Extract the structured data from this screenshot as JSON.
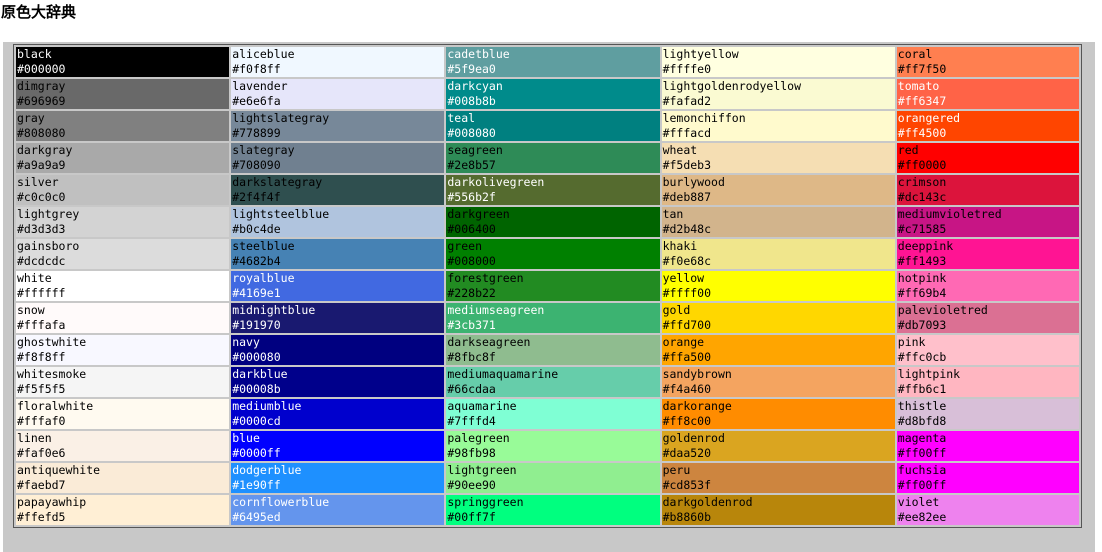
{
  "page": {
    "title": "原色大辞典"
  },
  "columns": [
    [
      {
        "name": "black",
        "hex": "#000000",
        "fg": "#ffffff"
      },
      {
        "name": "dimgray",
        "hex": "#696969",
        "fg": "#000000"
      },
      {
        "name": "gray",
        "hex": "#808080",
        "fg": "#000000"
      },
      {
        "name": "darkgray",
        "hex": "#a9a9a9",
        "fg": "#000000"
      },
      {
        "name": "silver",
        "hex": "#c0c0c0",
        "fg": "#000000"
      },
      {
        "name": "lightgrey",
        "hex": "#d3d3d3",
        "fg": "#000000"
      },
      {
        "name": "gainsboro",
        "hex": "#dcdcdc",
        "fg": "#000000"
      },
      {
        "name": "white",
        "hex": "#ffffff",
        "fg": "#000000"
      },
      {
        "name": "snow",
        "hex": "#fffafa",
        "fg": "#000000"
      },
      {
        "name": "ghostwhite",
        "hex": "#f8f8ff",
        "fg": "#000000"
      },
      {
        "name": "whitesmoke",
        "hex": "#f5f5f5",
        "fg": "#000000"
      },
      {
        "name": "floralwhite",
        "hex": "#fffaf0",
        "fg": "#000000"
      },
      {
        "name": "linen",
        "hex": "#faf0e6",
        "fg": "#000000"
      },
      {
        "name": "antiquewhite",
        "hex": "#faebd7",
        "fg": "#000000"
      },
      {
        "name": "papayawhip",
        "hex": "#ffefd5",
        "fg": "#000000"
      }
    ],
    [
      {
        "name": "aliceblue",
        "hex": "#f0f8ff",
        "fg": "#000000"
      },
      {
        "name": "lavender",
        "hex": "#e6e6fa",
        "fg": "#000000"
      },
      {
        "name": "lightslategray",
        "hex": "#778899",
        "fg": "#000000"
      },
      {
        "name": "slategray",
        "hex": "#708090",
        "fg": "#000000"
      },
      {
        "name": "darkslategray",
        "hex": "#2f4f4f",
        "fg": "#000000"
      },
      {
        "name": "lightsteelblue",
        "hex": "#b0c4de",
        "fg": "#000000"
      },
      {
        "name": "steelblue",
        "hex": "#4682b4",
        "fg": "#000000"
      },
      {
        "name": "royalblue",
        "hex": "#4169e1",
        "fg": "#ffffff"
      },
      {
        "name": "midnightblue",
        "hex": "#191970",
        "fg": "#ffffff"
      },
      {
        "name": "navy",
        "hex": "#000080",
        "fg": "#ffffff"
      },
      {
        "name": "darkblue",
        "hex": "#00008b",
        "fg": "#ffffff"
      },
      {
        "name": "mediumblue",
        "hex": "#0000cd",
        "fg": "#ffffff"
      },
      {
        "name": "blue",
        "hex": "#0000ff",
        "fg": "#ffffff"
      },
      {
        "name": "dodgerblue",
        "hex": "#1e90ff",
        "fg": "#ffffff"
      },
      {
        "name": "cornflowerblue",
        "hex": "#6495ed",
        "fg": "#ffffff"
      }
    ],
    [
      {
        "name": "cadetblue",
        "hex": "#5f9ea0",
        "fg": "#ffffff"
      },
      {
        "name": "darkcyan",
        "hex": "#008b8b",
        "fg": "#ffffff"
      },
      {
        "name": "teal",
        "hex": "#008080",
        "fg": "#ffffff"
      },
      {
        "name": "seagreen",
        "hex": "#2e8b57",
        "fg": "#000000"
      },
      {
        "name": "darkolivegreen",
        "hex": "#556b2f",
        "fg": "#ffffff"
      },
      {
        "name": "darkgreen",
        "hex": "#006400",
        "fg": "#000000"
      },
      {
        "name": "green",
        "hex": "#008000",
        "fg": "#000000"
      },
      {
        "name": "forestgreen",
        "hex": "#228b22",
        "fg": "#000000"
      },
      {
        "name": "mediumseagreen",
        "hex": "#3cb371",
        "fg": "#ffffff"
      },
      {
        "name": "darkseagreen",
        "hex": "#8fbc8f",
        "fg": "#000000"
      },
      {
        "name": "mediumaquamarine",
        "hex": "#66cdaa",
        "fg": "#000000"
      },
      {
        "name": "aquamarine",
        "hex": "#7fffd4",
        "fg": "#000000"
      },
      {
        "name": "palegreen",
        "hex": "#98fb98",
        "fg": "#000000"
      },
      {
        "name": "lightgreen",
        "hex": "#90ee90",
        "fg": "#000000"
      },
      {
        "name": "springgreen",
        "hex": "#00ff7f",
        "fg": "#000000"
      }
    ],
    [
      {
        "name": "lightyellow",
        "hex": "#ffffe0",
        "fg": "#000000"
      },
      {
        "name": "lightgoldenrodyellow",
        "hex": "#fafad2",
        "fg": "#000000"
      },
      {
        "name": "lemonchiffon",
        "hex": "#fffacd",
        "fg": "#000000"
      },
      {
        "name": "wheat",
        "hex": "#f5deb3",
        "fg": "#000000"
      },
      {
        "name": "burlywood",
        "hex": "#deb887",
        "fg": "#000000"
      },
      {
        "name": "tan",
        "hex": "#d2b48c",
        "fg": "#000000"
      },
      {
        "name": "khaki",
        "hex": "#f0e68c",
        "fg": "#000000"
      },
      {
        "name": "yellow",
        "hex": "#ffff00",
        "fg": "#000000"
      },
      {
        "name": "gold",
        "hex": "#ffd700",
        "fg": "#000000"
      },
      {
        "name": "orange",
        "hex": "#ffa500",
        "fg": "#000000"
      },
      {
        "name": "sandybrown",
        "hex": "#f4a460",
        "fg": "#000000"
      },
      {
        "name": "darkorange",
        "hex": "#ff8c00",
        "fg": "#000000"
      },
      {
        "name": "goldenrod",
        "hex": "#daa520",
        "fg": "#000000"
      },
      {
        "name": "peru",
        "hex": "#cd853f",
        "fg": "#000000"
      },
      {
        "name": "darkgoldenrod",
        "hex": "#b8860b",
        "fg": "#000000"
      }
    ],
    [
      {
        "name": "coral",
        "hex": "#ff7f50",
        "fg": "#000000"
      },
      {
        "name": "tomato",
        "hex": "#ff6347",
        "fg": "#ffffff"
      },
      {
        "name": "orangered",
        "hex": "#ff4500",
        "fg": "#ffffff"
      },
      {
        "name": "red",
        "hex": "#ff0000",
        "fg": "#000000"
      },
      {
        "name": "crimson",
        "hex": "#dc143c",
        "fg": "#000000"
      },
      {
        "name": "mediumvioletred",
        "hex": "#c71585",
        "fg": "#000000"
      },
      {
        "name": "deeppink",
        "hex": "#ff1493",
        "fg": "#000000"
      },
      {
        "name": "hotpink",
        "hex": "#ff69b4",
        "fg": "#000000"
      },
      {
        "name": "palevioletred",
        "hex": "#db7093",
        "fg": "#000000"
      },
      {
        "name": "pink",
        "hex": "#ffc0cb",
        "fg": "#000000"
      },
      {
        "name": "lightpink",
        "hex": "#ffb6c1",
        "fg": "#000000"
      },
      {
        "name": "thistle",
        "hex": "#d8bfd8",
        "fg": "#000000"
      },
      {
        "name": "magenta",
        "hex": "#ff00ff",
        "fg": "#000000"
      },
      {
        "name": "fuchsia",
        "hex": "#ff00ff",
        "fg": "#000000"
      },
      {
        "name": "violet",
        "hex": "#ee82ee",
        "fg": "#000000"
      }
    ]
  ]
}
